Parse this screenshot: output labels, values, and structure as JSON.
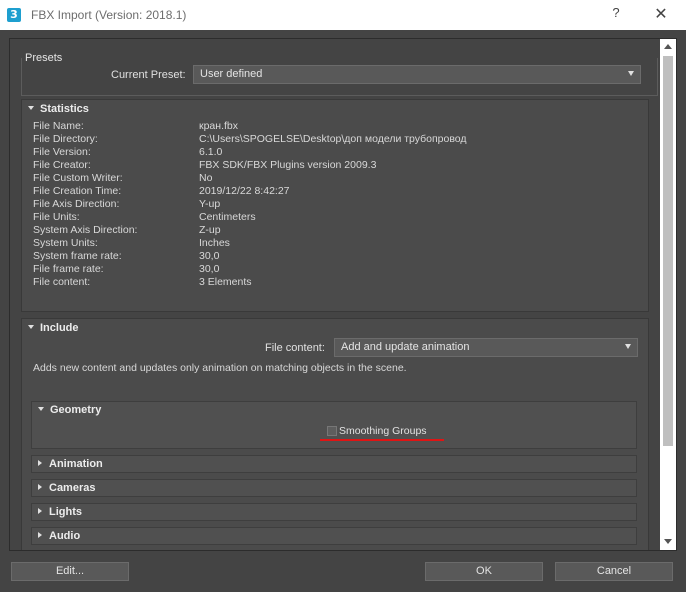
{
  "window": {
    "title": "FBX Import (Version: 2018.1)",
    "app_icon_text": "3",
    "help_label": "?",
    "close_label": "✕"
  },
  "presets": {
    "group_label": "Presets",
    "current_preset_label": "Current Preset:",
    "current_preset_value": "User defined"
  },
  "statistics": {
    "header": "Statistics",
    "rows": [
      {
        "label": "File Name:",
        "value": "кран.fbx"
      },
      {
        "label": "File Directory:",
        "value": "C:\\Users\\SPOGELSE\\Desktop\\доп модели трубопровод"
      },
      {
        "label": "File Version:",
        "value": "6.1.0"
      },
      {
        "label": "File Creator:",
        "value": "FBX SDK/FBX Plugins version 2009.3"
      },
      {
        "label": "File Custom Writer:",
        "value": "No"
      },
      {
        "label": "File Creation Time:",
        "value": "2019/12/22  8:42:27"
      },
      {
        "label": "File Axis Direction:",
        "value": "Y-up"
      },
      {
        "label": "File Units:",
        "value": "Centimeters"
      },
      {
        "label": "System Axis Direction:",
        "value": "Z-up"
      },
      {
        "label": "System Units:",
        "value": "Inches"
      },
      {
        "label": "System frame rate:",
        "value": "30,0"
      },
      {
        "label": "File frame rate:",
        "value": "30,0"
      },
      {
        "label": "File content:",
        "value": "3 Elements"
      }
    ]
  },
  "include": {
    "header": "Include",
    "file_content_label": "File content:",
    "file_content_value": "Add and update animation",
    "description": "Adds new content and updates only animation on matching objects in the scene.",
    "geometry": {
      "header": "Geometry",
      "smoothing_groups_label": "Smoothing Groups",
      "smoothing_groups_checked": false
    },
    "sections": [
      "Animation",
      "Cameras",
      "Lights",
      "Audio"
    ]
  },
  "buttons": {
    "edit": "Edit...",
    "ok": "OK",
    "cancel": "Cancel"
  },
  "colors": {
    "background": "#444444",
    "highlight_underline": "#e01414",
    "title_bar": "#ffffff"
  }
}
